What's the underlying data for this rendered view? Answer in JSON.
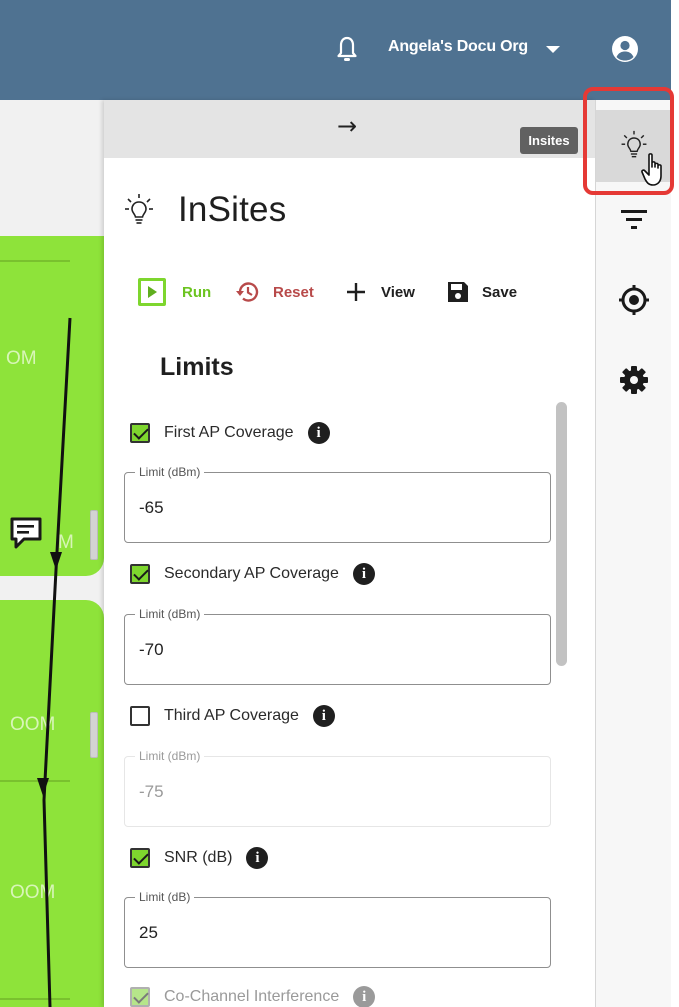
{
  "topbar": {
    "org_name": "Angela's Docu Org",
    "icons": [
      "bell-icon",
      "chevron-down-icon",
      "account-circle-icon"
    ],
    "background": "#4f7291"
  },
  "map": {
    "room_labels": [
      "OM",
      "M",
      "OOM",
      "OOM"
    ],
    "room_color": "#8ee33a"
  },
  "panel": {
    "collapse_icon": "arrow-right-icon",
    "tooltip": "Insites",
    "title": "InSites",
    "toolbar": {
      "run_label": "Run",
      "reset_label": "Reset",
      "view_label": "View",
      "save_label": "Save"
    },
    "section_title": "Limits",
    "limits": [
      {
        "label": "First AP Coverage",
        "checked": true,
        "field_label": "Limit (dBm)",
        "value": "-65",
        "enabled": true
      },
      {
        "label": "Secondary AP Coverage",
        "checked": true,
        "field_label": "Limit (dBm)",
        "value": "-70",
        "enabled": true
      },
      {
        "label": "Third AP Coverage",
        "checked": false,
        "field_label": "Limit (dBm)",
        "value": "-75",
        "enabled": false
      },
      {
        "label": "SNR (dB)",
        "checked": true,
        "field_label": "Limit (dB)",
        "value": "25",
        "enabled": true
      },
      {
        "label": "Co-Channel Interference",
        "checked": true,
        "enabled": false
      }
    ],
    "accent_green": "#7ed62e",
    "reset_color": "#b84a4a"
  },
  "rail": {
    "items": [
      "lightbulb-icon",
      "filter-icon",
      "target-icon",
      "gear-icon"
    ],
    "active": "lightbulb-icon",
    "highlight_color": "#e53935"
  }
}
